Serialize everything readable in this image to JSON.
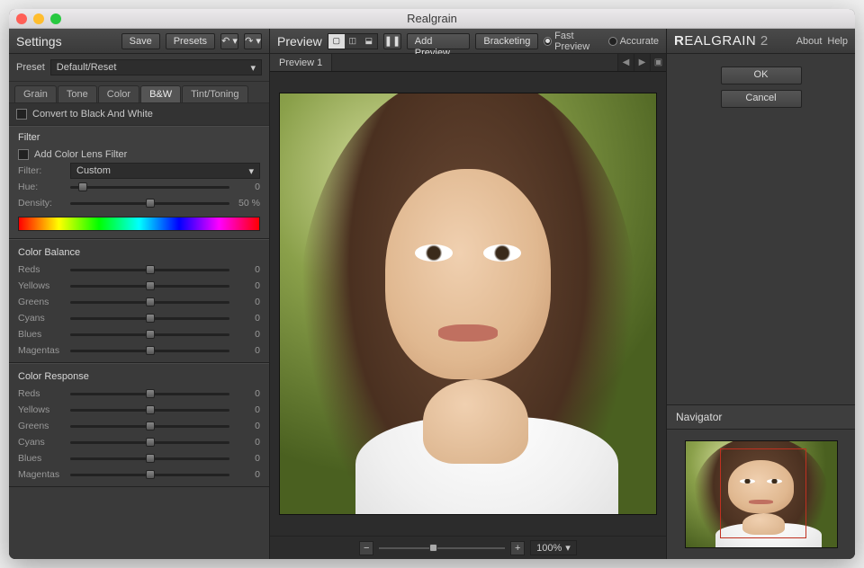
{
  "window": {
    "title": "Realgrain"
  },
  "settings": {
    "title": "Settings",
    "save": "Save",
    "presets": "Presets",
    "preset_label": "Preset",
    "preset_value": "Default/Reset",
    "tabs": {
      "grain": "Grain",
      "tone": "Tone",
      "color": "Color",
      "bw": "B&W",
      "tint": "Tint/Toning"
    },
    "convert_label": "Convert to Black And White",
    "filter": {
      "title": "Filter",
      "add_label": "Add Color Lens Filter",
      "filter_label": "Filter:",
      "filter_value": "Custom",
      "hue_label": "Hue:",
      "hue_value": "0",
      "density_label": "Density:",
      "density_value": "50",
      "density_unit": "%"
    },
    "color_balance": {
      "title": "Color Balance",
      "rows": [
        {
          "label": "Reds",
          "value": "0"
        },
        {
          "label": "Yellows",
          "value": "0"
        },
        {
          "label": "Greens",
          "value": "0"
        },
        {
          "label": "Cyans",
          "value": "0"
        },
        {
          "label": "Blues",
          "value": "0"
        },
        {
          "label": "Magentas",
          "value": "0"
        }
      ]
    },
    "color_response": {
      "title": "Color Response",
      "rows": [
        {
          "label": "Reds",
          "value": "0"
        },
        {
          "label": "Yellows",
          "value": "0"
        },
        {
          "label": "Greens",
          "value": "0"
        },
        {
          "label": "Cyans",
          "value": "0"
        },
        {
          "label": "Blues",
          "value": "0"
        },
        {
          "label": "Magentas",
          "value": "0"
        }
      ]
    }
  },
  "preview": {
    "title": "Preview",
    "add_preview": "Add Preview",
    "bracketing": "Bracketing",
    "fast_preview": "Fast Preview",
    "accurate": "Accurate",
    "tab1": "Preview 1",
    "zoom_value": "100%"
  },
  "brand": {
    "name1": "R",
    "name2": "EAL",
    "name3": "GRAIN",
    "ver": " 2"
  },
  "right": {
    "about": "About",
    "help": "Help",
    "ok": "OK",
    "cancel": "Cancel",
    "navigator": "Navigator"
  }
}
